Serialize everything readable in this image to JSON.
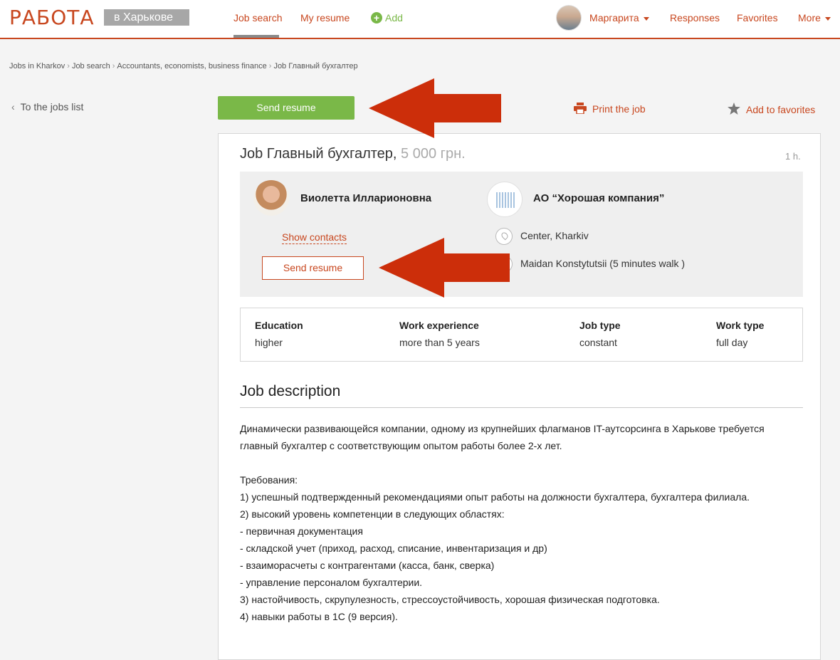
{
  "header": {
    "logo": "РАБОТА",
    "city": "в Харькове",
    "nav": {
      "job_search": "Job search",
      "my_resume": "My resume",
      "add": "Add"
    },
    "user_name": "Маргарита",
    "responses": "Responses",
    "favorites": "Favorites",
    "more": "More"
  },
  "breadcrumb": [
    "Jobs in Kharkov",
    "Job search",
    "Accountants, economists, business finance",
    "Job Главный бухгалтер"
  ],
  "back_link": "To the jobs list",
  "actions": {
    "send_resume": "Send resume",
    "print_job": "Print the job",
    "add_to_favorites": "Add to favorites"
  },
  "job": {
    "title": "Job Главный бухгалтер,",
    "salary": "5 000 грн.",
    "age": "1 h.",
    "contact_name": "Виолетта Илларионовна",
    "show_contacts": "Show contacts",
    "send_resume": "Send resume",
    "company": "АО “Хорошая компания”",
    "location": "Center, Kharkiv",
    "metro": "Maidan Konstytutsii (5 minutes walk )"
  },
  "info": [
    {
      "label": "Education",
      "value": "higher"
    },
    {
      "label": "Work experience",
      "value": "more than 5 years"
    },
    {
      "label": "Job type",
      "value": "constant"
    },
    {
      "label": "Work type",
      "value": "full day"
    }
  ],
  "description": {
    "heading": "Job description",
    "body": "Динамически развивающейся компании, одному из крупнейших флагманов IT-аутсорсинга в Харькове требуется главный бухгалтер с соответствующим опытом работы более 2-х лет.\n\nТребования:\n1) успешный подтвержденный рекомендациями опыт работы на должности бухгалтера, бухгалтера филиала.\n2) высокий уровень компетенции в следующих областях:\n- первичная документация\n- складской учет (приход, расход, списание, инвентаризация и др)\n- взаиморасчеты с контрагентами (касса, банк, сверка)\n- управление персоналом бухгалтерии.\n3) настойчивость, скрупулезность, стрессоустойчивость, хорошая физическая подготовка.\n4) навыки работы в 1С (9 версия)."
  },
  "colors": {
    "brand": "#c8471f",
    "accent_green": "#7ab848",
    "arrow_red": "#cc2e0a"
  }
}
